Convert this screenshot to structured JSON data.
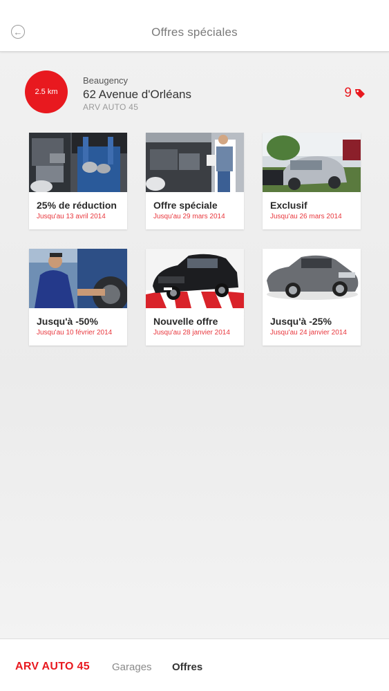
{
  "header": {
    "title": "Offres spéciales",
    "back_icon": "back-arrow-icon"
  },
  "garage": {
    "distance": "2.5 km",
    "city": "Beaugency",
    "address": "62 Avenue d'Orléans",
    "name": "ARV AUTO 45",
    "offer_count": "9",
    "count_icon": "tag-icon"
  },
  "offers": [
    {
      "title": "25% de réduction",
      "date": "Jusqu'au 13 avril 2014"
    },
    {
      "title": "Offre spéciale",
      "date": "Jusqu'au 29 mars 2014"
    },
    {
      "title": "Exclusif",
      "date": "Jusqu'au 26 mars 2014"
    },
    {
      "title": "Jusqu'à -50%",
      "date": "Jusqu'au 10 février 2014"
    },
    {
      "title": "Nouvelle offre",
      "date": "Jusqu'au 28 janvier 2014"
    },
    {
      "title": "Jusqu'à -25%",
      "date": "Jusqu'au 24 janvier 2014"
    }
  ],
  "bottom_nav": {
    "brand": "ARV AUTO 45",
    "garages": "Garages",
    "offres": "Offres"
  },
  "colors": {
    "accent": "#e8191f",
    "date_red": "#e8373d"
  }
}
